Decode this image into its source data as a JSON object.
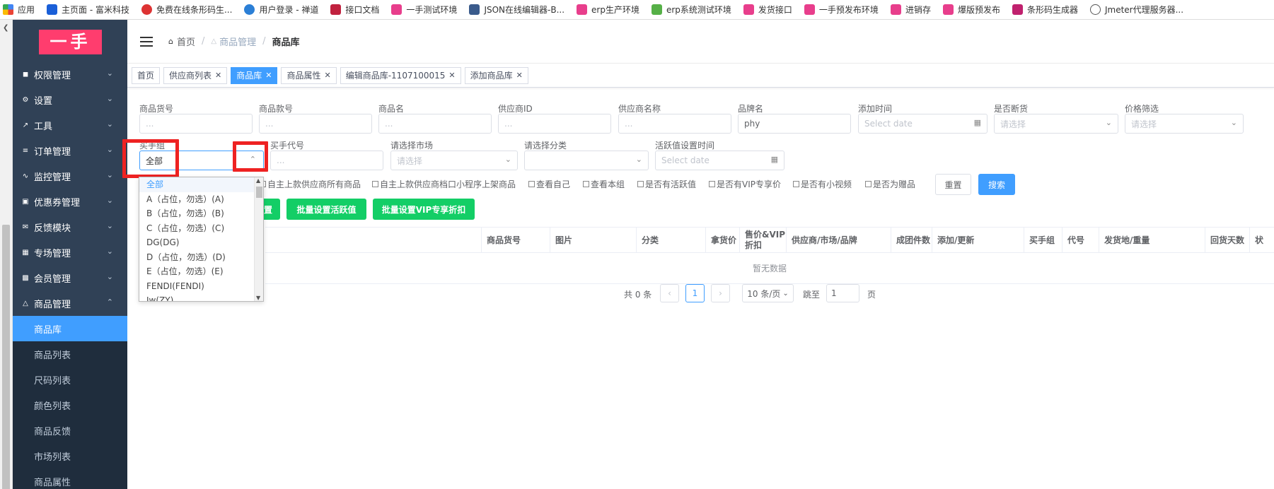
{
  "bookmarks": [
    {
      "label": "应用",
      "color": "#4285f4"
    },
    {
      "label": "主页面 - 富米科技",
      "color": "#1a5fd8"
    },
    {
      "label": "免费在线条形码生...",
      "color": "#d33"
    },
    {
      "label": "用户登录 - 禅道",
      "color": "#2b7fd6"
    },
    {
      "label": "接口文档",
      "color": "#c0213e"
    },
    {
      "label": "一手测试环境",
      "color": "#e83e8c"
    },
    {
      "label": "JSON在线编辑器-B...",
      "color": "#3a5b8c"
    },
    {
      "label": "erp生产环境",
      "color": "#e83e8c"
    },
    {
      "label": "erp系统测试环境",
      "color": "#56b047"
    },
    {
      "label": "发货接口",
      "color": "#e83e8c"
    },
    {
      "label": "一手预发布环境",
      "color": "#e83e8c"
    },
    {
      "label": "进销存",
      "color": "#e83e8c"
    },
    {
      "label": "爆版预发布",
      "color": "#e83e8c"
    },
    {
      "label": "条形码生成器",
      "color": "#c0216e"
    },
    {
      "label": "Jmeter代理服务器...",
      "color": "#555555"
    }
  ],
  "brand": {
    "logo_text": "一手",
    "logo_color": "#ff3d6e"
  },
  "sidebar": {
    "menus": [
      {
        "label": "权限管理",
        "icon": "lock-icon"
      },
      {
        "label": "设置",
        "icon": "gear-icon"
      },
      {
        "label": "工具",
        "icon": "tool-icon"
      },
      {
        "label": "订单管理",
        "icon": "list-icon"
      },
      {
        "label": "监控管理",
        "icon": "monitor-icon"
      },
      {
        "label": "优惠券管理",
        "icon": "coupon-icon"
      },
      {
        "label": "反馈模块",
        "icon": "mail-icon"
      },
      {
        "label": "专场管理",
        "icon": "grid-icon"
      },
      {
        "label": "会员管理",
        "icon": "member-icon"
      },
      {
        "label": "商品管理",
        "icon": "shirt-icon"
      }
    ],
    "submenus": [
      "商品库",
      "商品列表",
      "尺码列表",
      "颜色列表",
      "商品反馈",
      "市场列表",
      "商品属性"
    ]
  },
  "breadcrumb": {
    "home": "首页",
    "parent": "商品管理",
    "current": "商品库"
  },
  "tags": [
    "首页",
    "供应商列表",
    "商品库",
    "商品属性",
    "编辑商品库-1107100015",
    "添加商品库"
  ],
  "filters": {
    "row1": [
      {
        "label": "商品货号",
        "value": "",
        "placeholder": "..."
      },
      {
        "label": "商品款号",
        "value": "",
        "placeholder": "..."
      },
      {
        "label": "商品名",
        "value": "",
        "placeholder": "..."
      },
      {
        "label": "供应商ID",
        "value": "",
        "placeholder": "..."
      },
      {
        "label": "供应商名称",
        "value": "",
        "placeholder": "..."
      },
      {
        "label": "品牌名",
        "value": "phy",
        "placeholder": ""
      },
      {
        "label": "添加时间",
        "value": "",
        "placeholder": "Select date"
      },
      {
        "label": "是否断货",
        "value": "",
        "placeholder": "请选择"
      },
      {
        "label": "价格筛选",
        "value": "",
        "placeholder": "请选择"
      }
    ],
    "buyer_group": {
      "label": "买手组",
      "value": "全部"
    },
    "buyer_code": {
      "label": "买手代号",
      "placeholder": "..."
    },
    "market": {
      "label": "请选择市场",
      "placeholder": "请选择"
    },
    "category": {
      "label": "请选择分类",
      "placeholder": ""
    },
    "active_time": {
      "label": "活跃值设置时间",
      "placeholder": "Select date"
    }
  },
  "checkboxes": [
    "自主上款供应商所有商品",
    "自主上款供应商档口小程序上架商品",
    "查看自己",
    "查看本组",
    "是否有活跃值",
    "是否有VIP专享价",
    "是否有小视频",
    "是否为赠品"
  ],
  "buttons": {
    "reset": "重置",
    "search": "搜索",
    "batch_partial": "置",
    "batch_active": "批量设置活跃值",
    "batch_vip": "批量设置VIP专享折扣"
  },
  "table": {
    "columns": [
      "商品货号",
      "图片",
      "分类",
      "拿货价",
      "售价&VIP折扣",
      "供应商/市场/品牌",
      "成团件数",
      "添加/更新",
      "买手组",
      "代号",
      "发货地/重量",
      "回货天数",
      "状"
    ],
    "empty_text": "暂无数据"
  },
  "pagination": {
    "total": "共 0 条",
    "current_page": "1",
    "page_size": "10 条/页",
    "jump_label": "跳至",
    "jump_value": "1",
    "page_unit": "页"
  },
  "dropdown": {
    "options": [
      "全部",
      "A（占位，勿选）(A)",
      "B（占位，勿选）(B)",
      "C（占位，勿选）(C)",
      "DG(DG)",
      "D（占位，勿选）(D)",
      "E（占位，勿选）(E)",
      "FENDI(FENDI)",
      "Jw(ZY)"
    ],
    "selected": "全部"
  },
  "colors": {
    "primary": "#409eff",
    "success": "#13ce66",
    "sidebar_bg": "#304156",
    "highlight": "#ee2222"
  }
}
